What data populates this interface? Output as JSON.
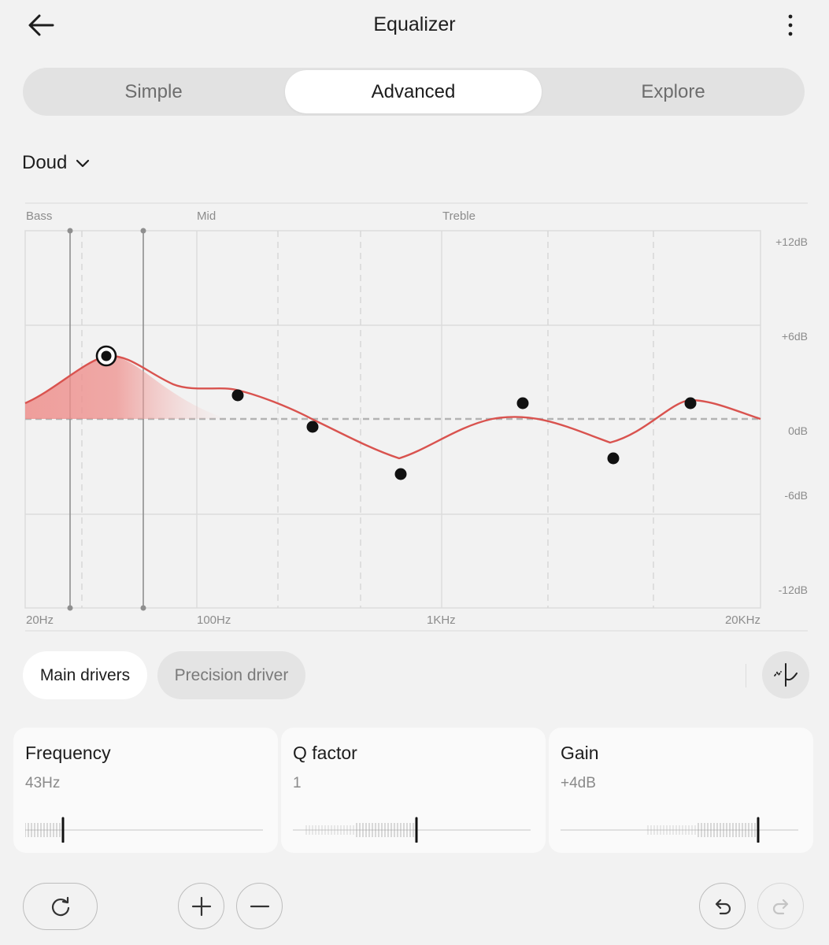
{
  "header": {
    "title": "Equalizer",
    "back_icon": "arrow-left-icon",
    "more_icon": "more-vertical-icon"
  },
  "tabs": [
    {
      "label": "Simple",
      "selected": false
    },
    {
      "label": "Advanced",
      "selected": true
    },
    {
      "label": "Explore",
      "selected": false
    }
  ],
  "preset": {
    "name": "Doud",
    "icon": "chevron-down-icon"
  },
  "graph": {
    "band_labels": [
      "Bass",
      "Mid",
      "Treble"
    ],
    "freq_labels": [
      "20Hz",
      "100Hz",
      "1KHz",
      "20KHz"
    ],
    "db_labels": [
      "+12dB",
      "+6dB",
      "0dB",
      "-6dB",
      "-12dB"
    ],
    "db_range": [
      -12,
      12
    ],
    "freq_range_hz": [
      20,
      20000
    ],
    "selected_point": {
      "freq_hz": 43,
      "gain_db": 4
    },
    "points": [
      {
        "freq_hz": 43,
        "gain_db": 4,
        "selected": true
      },
      {
        "freq_hz": 130,
        "gain_db": 1.5
      },
      {
        "freq_hz": 250,
        "gain_db": -0.5
      },
      {
        "freq_hz": 700,
        "gain_db": -3.5
      },
      {
        "freq_hz": 1900,
        "gain_db": 1
      },
      {
        "freq_hz": 5200,
        "gain_db": -2.5
      },
      {
        "freq_hz": 11500,
        "gain_db": 1
      },
      {
        "freq_hz": 20000,
        "gain_db": 0
      }
    ],
    "curve_color": "#d9534f",
    "fill_color": "#ee9a98"
  },
  "drivers": {
    "main_label": "Main drivers",
    "precision_label": "Precision driver",
    "selected": "Main drivers",
    "curve_icon": "curve-mode-icon"
  },
  "params": [
    {
      "label": "Frequency",
      "value": "43Hz",
      "level": 0.16
    },
    {
      "label": "Q factor",
      "value": "1",
      "level": 0.52
    },
    {
      "label": "Gain",
      "value": "+4dB",
      "level": 0.83
    }
  ],
  "actions": {
    "reset_icon": "reset-icon",
    "add_icon": "plus-icon",
    "remove_icon": "minus-icon",
    "undo_icon": "undo-icon",
    "redo_icon": "redo-icon"
  }
}
